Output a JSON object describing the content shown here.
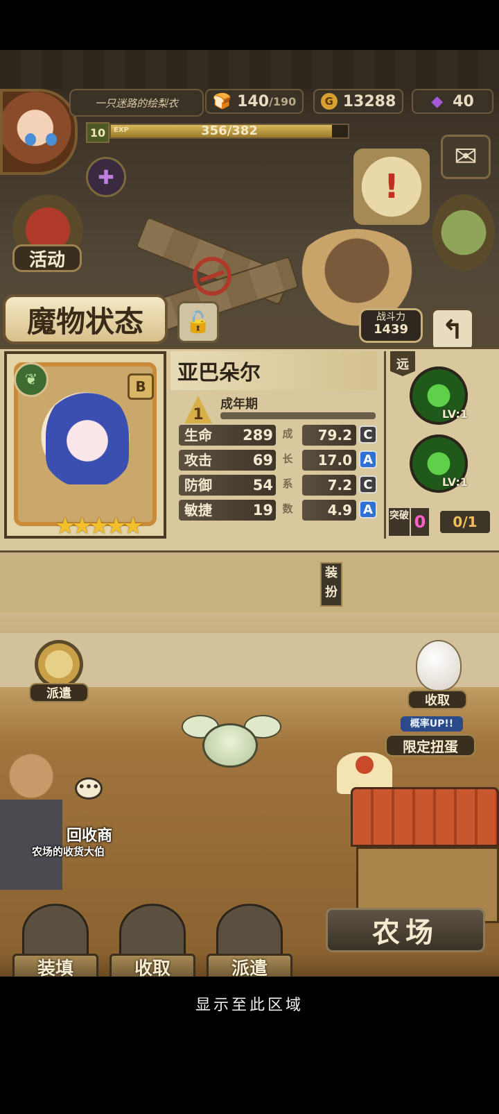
{
  "player": {
    "name": "一只迷路的绘梨衣",
    "level": "10",
    "exp_label": "EXP",
    "exp_text": "356/382",
    "exp_fraction": 0.932
  },
  "resources": {
    "stamina": "140",
    "stamina_max": "/190",
    "gold": "13288",
    "gems": "40"
  },
  "side_buttons": {
    "activity": "活动"
  },
  "screen": {
    "title": "魔物状态",
    "power_label": "战斗力",
    "power_value": "1439"
  },
  "monster": {
    "name": "亚巴朵尔",
    "rank": "B",
    "stars": "★★★★★",
    "stage_level": "1",
    "stage_name": "成年期",
    "stats": [
      {
        "name": "生命",
        "value": "289",
        "growth_char": "成",
        "growth": "79.2",
        "grade": "C"
      },
      {
        "name": "攻击",
        "value": "69",
        "growth_char": "长",
        "growth": "17.0",
        "grade": "A"
      },
      {
        "name": "防御",
        "value": "54",
        "growth_char": "系",
        "growth": "7.2",
        "grade": "C"
      },
      {
        "name": "敏捷",
        "value": "19",
        "growth_char": "数",
        "growth": "4.9",
        "grade": "A"
      }
    ],
    "range_tag": "远",
    "skills": [
      {
        "level": "LV:1"
      },
      {
        "level": "LV:1"
      }
    ],
    "break_label": "突破",
    "break_value": "0",
    "break_count": "0/1",
    "equip_label": "装扮"
  },
  "farm": {
    "dispatch_label": "派遣",
    "collect_label": "收取",
    "rate_up": "概率UP!!",
    "limited_label": "限定扭蛋",
    "merchant_name": "回收商",
    "merchant_desc": "农场的收货大伯",
    "bubble": "•••",
    "bottom_buttons": [
      "装填",
      "收取",
      "派遣"
    ],
    "farm_label": "农场"
  },
  "footer": {
    "text": "显示至此区域"
  },
  "colors": {
    "grade_C": "#3f3f3f",
    "grade_A": "#2f6fd6",
    "break_pink": "#ff5fc8",
    "gold": "#f4c02a"
  }
}
